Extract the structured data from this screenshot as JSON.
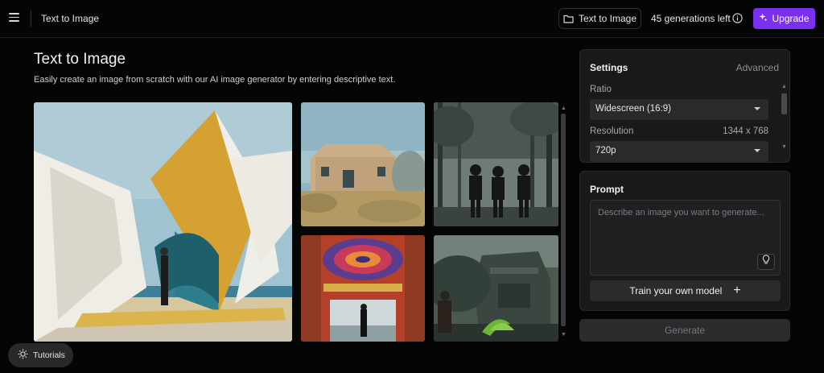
{
  "header": {
    "title": "Text to Image",
    "folder_button_label": "Text to Image",
    "generations_left": "45 generations left",
    "upgrade_label": "Upgrade"
  },
  "page": {
    "title": "Text to Image",
    "subtitle": "Easily create an image from scratch with our AI image generator by entering descriptive text."
  },
  "gallery": {
    "images": [
      "white-and-yellow-curved-sculpture-with-man-on-beach",
      "stone-farmhouse-in-dry-brush",
      "three-silhouettes-in-misty-forest",
      "figure-in-doorway-under-red-mandala",
      "overgrown-jungle-temple-with-person"
    ]
  },
  "settings": {
    "title": "Settings",
    "advanced_label": "Advanced",
    "ratio_label": "Ratio",
    "ratio_value": "Widescreen (16:9)",
    "resolution_label": "Resolution",
    "resolution_dims": "1344 x 768",
    "resolution_value": "720p"
  },
  "prompt": {
    "title": "Prompt",
    "placeholder": "Describe an image you want to generate...",
    "value": "",
    "train_label": "Train your own model"
  },
  "generate_label": "Generate",
  "tutorials_label": "Tutorials",
  "colors": {
    "accent": "#7b2ff0",
    "background": "#050505",
    "panel": "#19191b"
  },
  "icons": {
    "menu": "hamburger-menu-icon",
    "folder": "folder-icon",
    "info": "info-icon",
    "upgrade": "sparkle-icon",
    "lightbulb": "lightbulb-icon",
    "plus": "plus-icon",
    "tutorials": "lightbulb-icon"
  }
}
